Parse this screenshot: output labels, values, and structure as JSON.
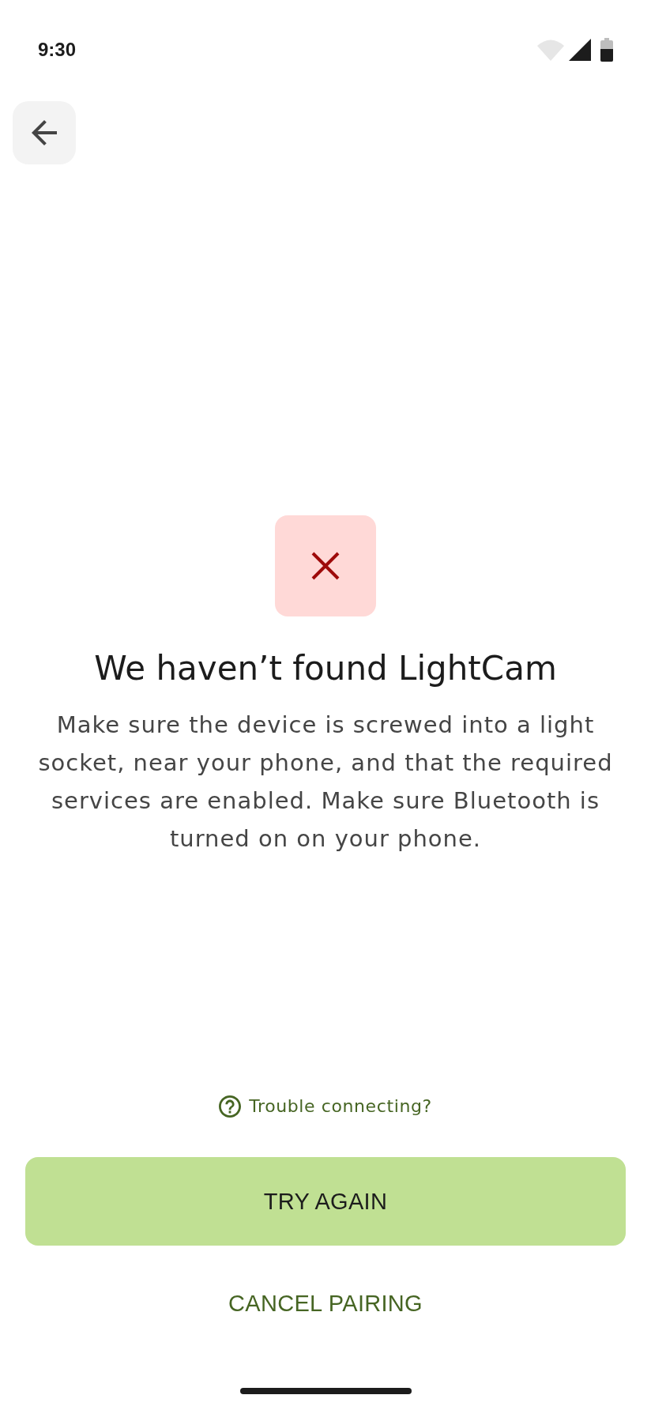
{
  "status_bar": {
    "time": "9:30"
  },
  "error": {
    "title": "We haven’t found LightCam",
    "message": "Make sure the device is screwed into a light socket, near your phone, and that the required services are enabled. Make sure Bluetooth is turned on on your phone."
  },
  "help_link": {
    "label": "Trouble connecting?"
  },
  "buttons": [
    {
      "label": "TRY AGAIN",
      "kind": "primary"
    },
    {
      "label": "CANCEL PAIRING",
      "kind": "text"
    }
  ]
}
